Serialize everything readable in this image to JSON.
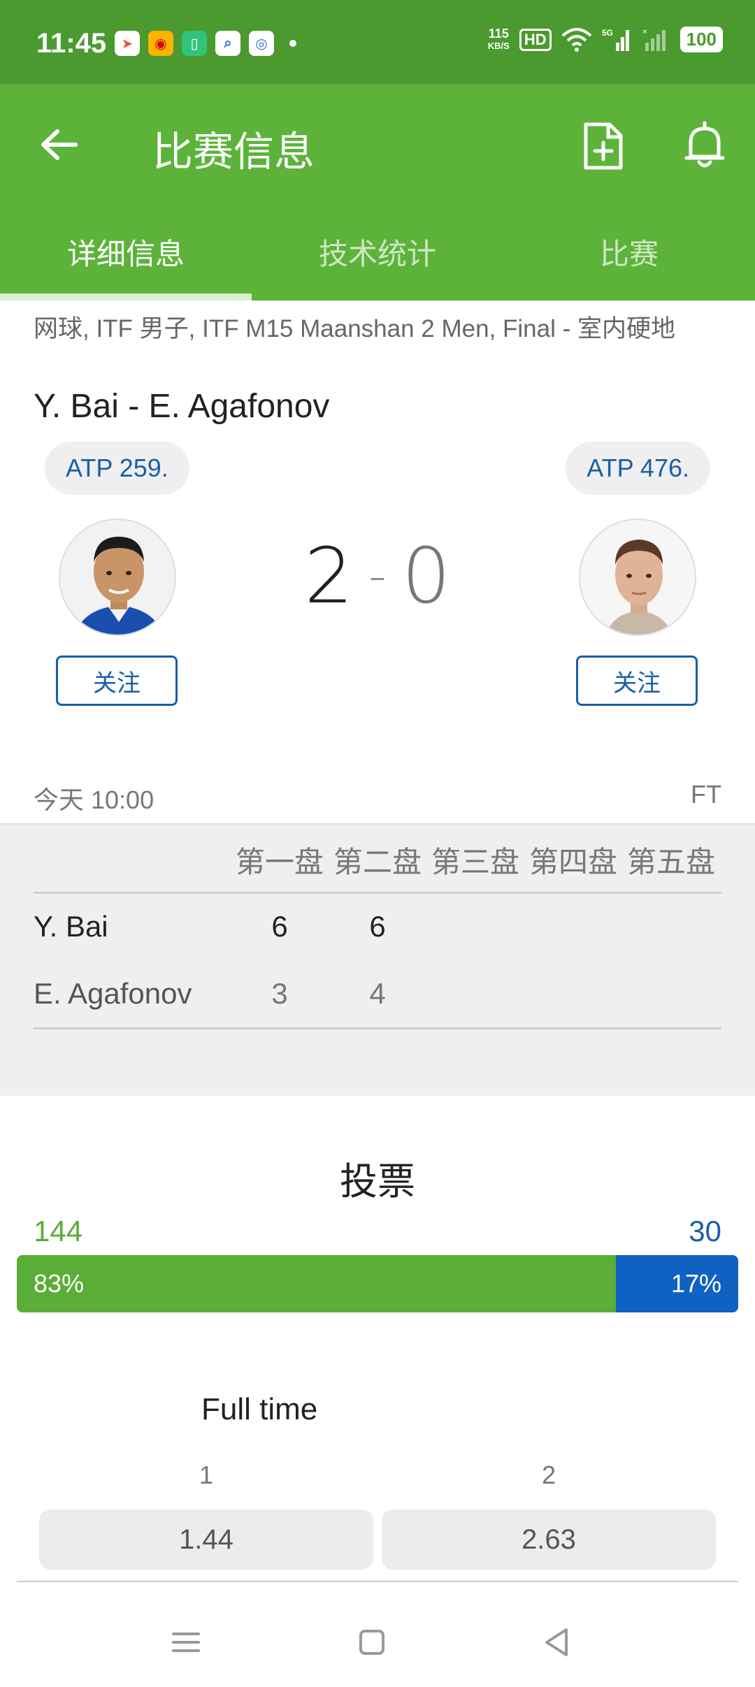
{
  "status_bar": {
    "time": "11:45",
    "net_speed_value": "115",
    "net_speed_unit": "KB/S",
    "hd": "HD",
    "battery": "100"
  },
  "app_bar": {
    "title": "比赛信息",
    "tabs": [
      {
        "label": "详细信息",
        "active": true
      },
      {
        "label": "技术统计",
        "active": false
      },
      {
        "label": "比赛",
        "active": false
      }
    ]
  },
  "match": {
    "breadcrumb": "网球, ITF 男子, ITF M15 Maanshan 2 Men, Final - 室内硬地",
    "title": "Y. Bai - E. Agafonov",
    "home": {
      "rank": "ATP 259.",
      "follow_label": "关注",
      "score": "2"
    },
    "away": {
      "rank": "ATP 476.",
      "follow_label": "关注",
      "score": "0"
    },
    "score_separator": "-",
    "start_time": "今天 10:00",
    "status": "FT"
  },
  "sets": {
    "headers": [
      "第一盘",
      "第二盘",
      "第三盘",
      "第四盘",
      "第五盘"
    ],
    "rows": [
      {
        "player": "Y. Bai",
        "scores": [
          "6",
          "6",
          "",
          "",
          ""
        ]
      },
      {
        "player": "E. Agafonov",
        "scores": [
          "3",
          "4",
          "",
          "",
          ""
        ]
      }
    ]
  },
  "votes": {
    "title": "投票",
    "home_count": "144",
    "away_count": "30",
    "home_pct_label": "83%",
    "away_pct_label": "17%",
    "home_fraction": 0.83
  },
  "odds": {
    "title": "Full time",
    "labels": [
      "1",
      "2"
    ],
    "values": [
      "1.44",
      "2.63"
    ]
  },
  "colors": {
    "status_bar": "#4a9a2f",
    "app_bar": "#5db33a",
    "home_accent": "#5aad37",
    "away_accent": "#1062c2",
    "link_blue": "#1a5ea8"
  },
  "icons": [
    "back-arrow-icon",
    "add-document-icon",
    "bell-icon",
    "menu-icon",
    "home-square-icon",
    "back-triangle-icon"
  ]
}
